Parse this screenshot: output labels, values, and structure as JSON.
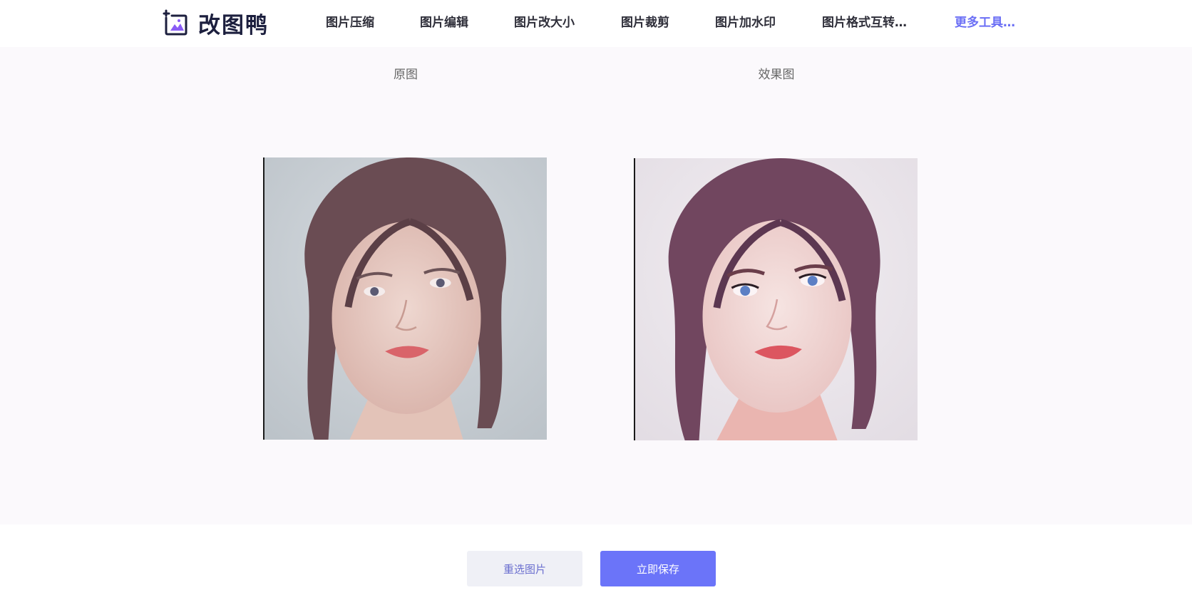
{
  "header": {
    "logo_text": "改图鸭",
    "logo_icon": "picture-frame-icon",
    "nav": [
      {
        "label": "图片压缩"
      },
      {
        "label": "图片编辑"
      },
      {
        "label": "图片改大小"
      },
      {
        "label": "图片裁剪"
      },
      {
        "label": "图片加水印"
      },
      {
        "label": "图片格式互转…"
      },
      {
        "label": "更多工具…"
      }
    ]
  },
  "compare": {
    "original_label": "原图",
    "result_label": "效果图"
  },
  "actions": {
    "reselect_label": "重选图片",
    "save_label": "立即保存"
  },
  "colors": {
    "accent": "#6b74f9",
    "nav_more": "#6b6ff5",
    "stage_bg": "#fbf9fc",
    "reselect_bg": "#eff0f6"
  }
}
